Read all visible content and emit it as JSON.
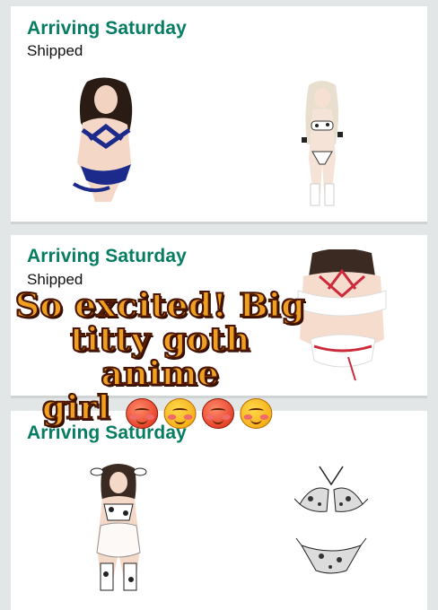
{
  "orders": [
    {
      "status": "Arriving Saturday",
      "substatus": "Shipped"
    },
    {
      "status": "Arriving Saturday",
      "substatus": "Shipped"
    },
    {
      "status": "Arriving Saturday"
    }
  ],
  "overlay": {
    "line1": "So excited! Big",
    "line2": "titty goth anime",
    "line3": "girl"
  },
  "icons": {
    "emoji": [
      "face-with-hearts-emoji",
      "smiling-face-with-hearts-emoji",
      "hot-face-emoji",
      "smiling-face-with-hearts-emoji"
    ]
  }
}
